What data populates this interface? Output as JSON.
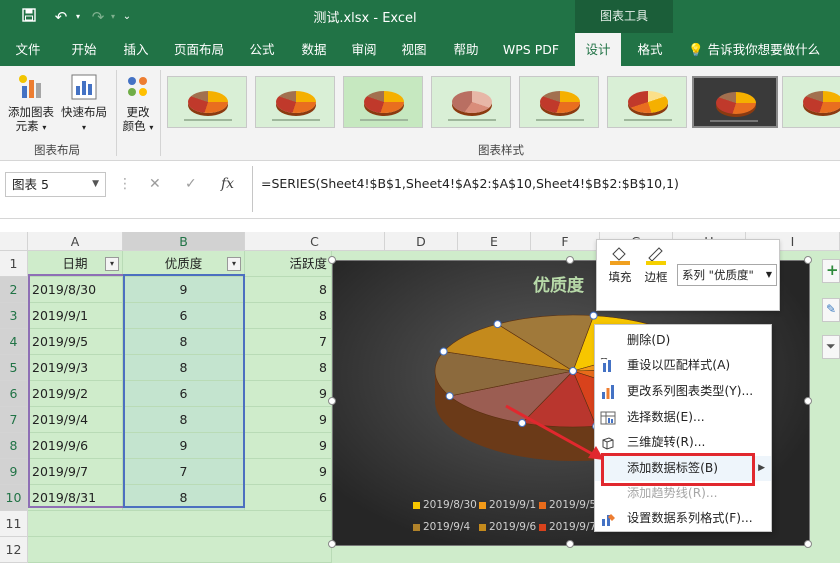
{
  "title_bar": {
    "save_icon": "save-icon",
    "undo_icon": "undo-icon",
    "redo_icon": "redo-icon",
    "customize_icon": "customize-qat-icon",
    "document_title": "测试.xlsx  -  Excel",
    "contextual_tab_group": "图表工具"
  },
  "tabs": [
    "文件",
    "开始",
    "插入",
    "页面布局",
    "公式",
    "数据",
    "审阅",
    "视图",
    "帮助",
    "WPS PDF",
    "设计",
    "格式"
  ],
  "active_tab": "设计",
  "tell_me": "告诉我你想要做什么",
  "ribbon": {
    "add_chart_element": [
      "添加图表",
      "元素"
    ],
    "quick_layout": "快速布局",
    "change_colors": [
      "更改",
      "颜色"
    ],
    "group_chart_layout": "图表布局",
    "group_chart_styles": "图表样式"
  },
  "formula_bar": {
    "name_box": "图表 5",
    "cancel_icon": "✕",
    "enter_icon": "✓",
    "fx": "fx",
    "formula": "=SERIES(Sheet4!$B$1,Sheet4!$A$2:$A$10,Sheet4!$B$2:$B$10,1)"
  },
  "columns": [
    "A",
    "B",
    "C",
    "D",
    "E",
    "F",
    "G",
    "H",
    "I"
  ],
  "rows": [
    "1",
    "2",
    "3",
    "4",
    "5",
    "6",
    "7",
    "8",
    "9",
    "10",
    "11",
    "12"
  ],
  "table": {
    "headers": [
      "日期",
      "优质度",
      "活跃度"
    ],
    "dates": [
      "2019/8/30",
      "2019/9/1",
      "2019/9/5",
      "2019/9/3",
      "2019/9/2",
      "2019/9/4",
      "2019/9/6",
      "2019/9/7",
      "2019/8/31"
    ],
    "quality": [
      "9",
      "6",
      "8",
      "8",
      "6",
      "8",
      "9",
      "7",
      "8"
    ],
    "activity": [
      "8",
      "8",
      "7",
      "8",
      "9",
      "9",
      "9",
      "9",
      "6"
    ]
  },
  "chart": {
    "title": "优质度",
    "legend": [
      "2019/8/30",
      "2019/9/1",
      "2019/9/5",
      "2019/9/4",
      "2019/9/6",
      "2019/9/7"
    ],
    "slice_colors": [
      "#f7c600",
      "#f29a18",
      "#e86b1a",
      "#d8421c",
      "#b9362e",
      "#9b5d52",
      "#8c6a3d",
      "#c48a1c",
      "#a0793a"
    ]
  },
  "mini_toolbar": {
    "fill": "填充",
    "outline": "边框",
    "series_select": "系列 \"优质度\""
  },
  "context_menu": [
    {
      "label": "删除(D)",
      "icon": "",
      "disabled": false
    },
    {
      "label": "重设以匹配样式(A)",
      "icon": "reset-style-icon",
      "disabled": false
    },
    {
      "label": "更改系列图表类型(Y)...",
      "icon": "chart-type-icon",
      "disabled": false
    },
    {
      "label": "选择数据(E)...",
      "icon": "select-data-icon",
      "disabled": false
    },
    {
      "label": "三维旋转(R)...",
      "icon": "rotate-3d-icon",
      "disabled": false
    },
    {
      "label": "添加数据标签(B)",
      "icon": "",
      "disabled": false
    },
    {
      "label": "添加趋势线(R)...",
      "icon": "",
      "disabled": true
    },
    {
      "label": "设置数据系列格式(F)...",
      "icon": "format-series-icon",
      "disabled": false
    }
  ]
}
